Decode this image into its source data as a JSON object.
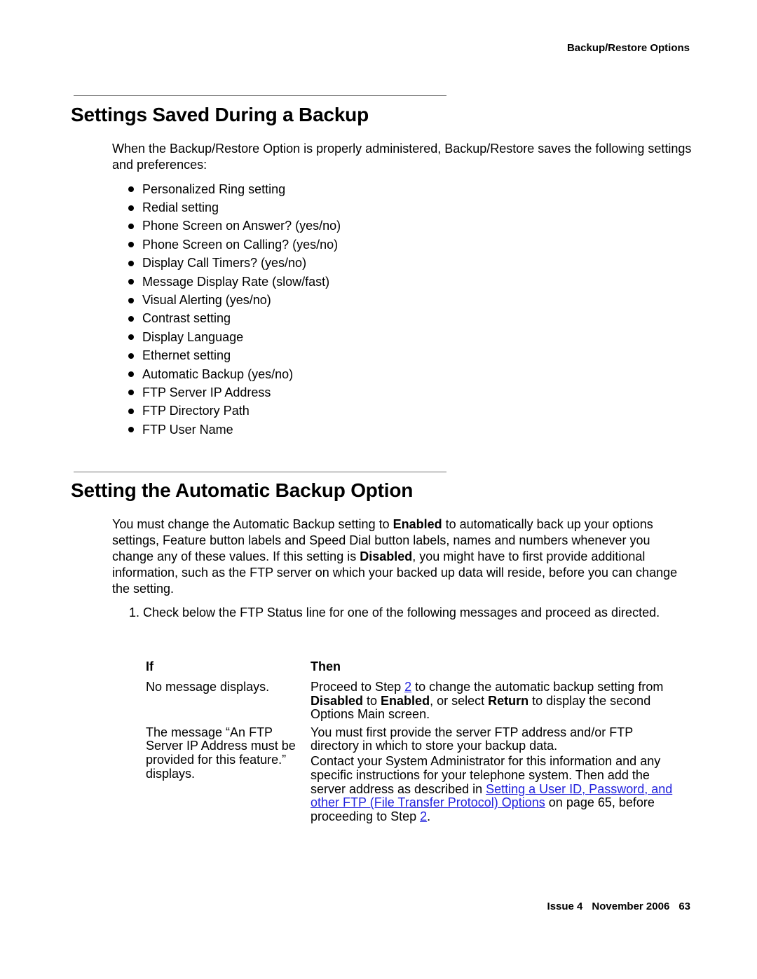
{
  "header": {
    "running_title": "Backup/Restore Options"
  },
  "section1": {
    "title": "Settings Saved During a Backup",
    "intro": "When the Backup/Restore Option is properly administered, Backup/Restore saves the following settings and preferences:",
    "items": [
      "Personalized Ring setting",
      "Redial setting",
      "Phone Screen on Answer? (yes/no)",
      "Phone Screen on Calling? (yes/no)",
      "Display Call Timers? (yes/no)",
      "Message Display Rate (slow/fast)",
      "Visual Alerting (yes/no)",
      "Contrast setting",
      "Display Language",
      "Ethernet setting",
      "Automatic Backup (yes/no)",
      "FTP Server IP Address",
      "FTP Directory Path",
      "FTP User Name"
    ]
  },
  "section2": {
    "title": "Setting the Automatic Backup Option",
    "para": {
      "t1": "You must change the Automatic Backup setting to ",
      "b1": "Enabled",
      "t2": " to automatically back up your options settings, Feature button labels and Speed Dial button labels, names and numbers whenever you change any of these values. If this setting is ",
      "b2": "Disabled",
      "t3": ", you might have to first provide additional information, such as the FTP server on which your backed up data will reside, before you can change the setting."
    },
    "step1": {
      "number": "1.",
      "text": "Check below the FTP Status line for one of the following messages and proceed as directed."
    },
    "table": {
      "header_if": "If",
      "header_then": "Then",
      "row1": {
        "if": "No message displays.",
        "then_t1": "Proceed to Step ",
        "then_link1": "2",
        "then_t2": " to change the automatic backup setting from ",
        "then_b1": "Disabled",
        "then_t3": " to ",
        "then_b2": "Enabled",
        "then_t4": ", or select ",
        "then_b3": "Return",
        "then_t5": " to display the second Options Main screen."
      },
      "row2": {
        "if": "The message “An FTP Server IP Address must be provided for this feature.” displays.",
        "then_p1": "You must first provide the server FTP address and/or FTP directory in which to store your backup data.",
        "then_t1": "Contact your System Administrator for this information and any specific instructions for your telephone system. Then add the server address as described in ",
        "then_link1": "Setting a User ID, Password, and other FTP (File Transfer Protocol) Options",
        "then_t2": " on page 65, before proceeding to Step ",
        "then_link2": "2",
        "then_t3": "."
      }
    }
  },
  "footer": {
    "issue": "Issue 4",
    "date": "November 2006",
    "page": "63"
  },
  "colors": {
    "link": "#2222dd",
    "rule": "#6f6f6f"
  }
}
